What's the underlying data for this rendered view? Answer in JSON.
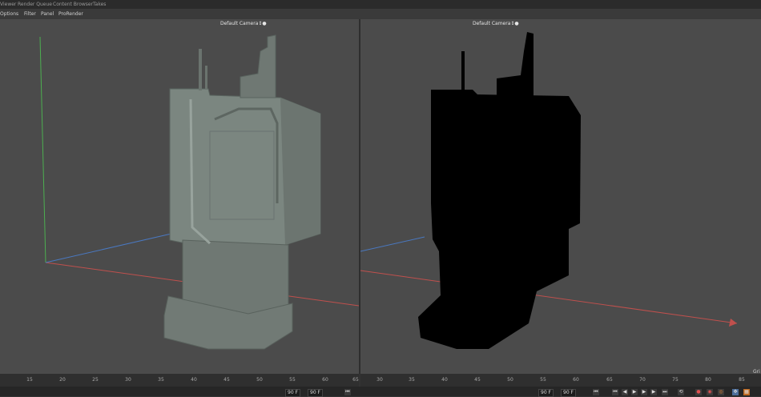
{
  "top_menu": [
    "Viewer",
    "Render Queue",
    "Content Browser",
    "Takes"
  ],
  "menu_bar": [
    "Options",
    "Filter",
    "Panel",
    "ProRender"
  ],
  "viewports": {
    "left": {
      "camera_label": "Default Camera"
    },
    "right": {
      "camera_label": "Default Camera"
    }
  },
  "timeline": {
    "left_ticks": [
      "15",
      "20",
      "25",
      "30",
      "35",
      "40",
      "45",
      "50",
      "55",
      "60",
      "65"
    ],
    "right_ticks": [
      "30",
      "35",
      "40",
      "45",
      "50",
      "55",
      "60",
      "65",
      "70",
      "75",
      "80",
      "85"
    ]
  },
  "playback": {
    "left_start": "90 F",
    "left_end": "90 F",
    "right_start": "90 F",
    "right_end": "90 F"
  },
  "grid_label": "Gri",
  "colors": {
    "viewport_bg": "#4b4b4b",
    "axis_x": "#c0504d",
    "axis_y": "#4caf50",
    "axis_z": "#4a78c0",
    "model_gray": "#7b8680",
    "silhouette": "#000000"
  },
  "icons": [
    "skip-start-icon",
    "step-back-icon",
    "play-icon",
    "step-forward-icon",
    "skip-end-icon",
    "record-icon",
    "keyframe-icon",
    "autokey-icon"
  ]
}
